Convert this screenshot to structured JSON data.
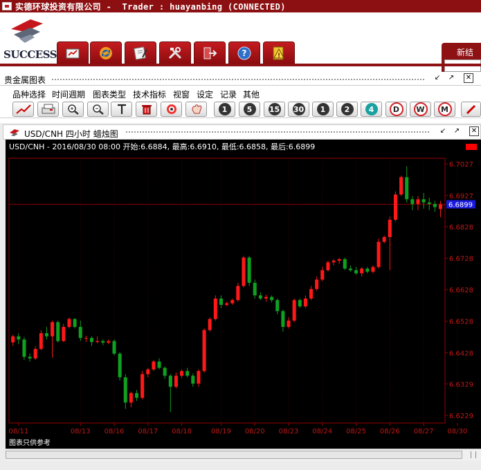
{
  "window": {
    "title": "实德环球投资有限公司 -  Trader : huayanbing (CONNECTED)"
  },
  "logo": {
    "text": "SUCCESS"
  },
  "right_tab": {
    "label": "新结存"
  },
  "main_toolbar": [
    {
      "icon": "chart-book-icon"
    },
    {
      "icon": "refresh-icon"
    },
    {
      "icon": "notes-icon"
    },
    {
      "icon": "tools-icon"
    },
    {
      "icon": "exit-icon"
    },
    {
      "icon": "help-icon"
    },
    {
      "icon": "warning-icon"
    }
  ],
  "panel": {
    "title": "贵金属图表"
  },
  "menu": [
    "品种选择",
    "时间週期",
    "图表类型",
    "技术指标",
    "视窗",
    "设定",
    "记录",
    "其他"
  ],
  "periods": [
    "1",
    "5",
    "15",
    "30",
    "1",
    "2",
    "4"
  ],
  "period_letters": [
    "D",
    "W",
    "M"
  ],
  "chart_window": {
    "title": "USD/CNH 四小时 蜡烛图"
  },
  "chart_data": {
    "type": "candlestick",
    "info": "USD/CNH - 2016/08/30 08:00 开始:6.6884, 最高:6.6910, 最低:6.6858, 最后:6.6899",
    "footer": "图表只供参考",
    "last_price": "6.6899",
    "last_value": 6.6899,
    "y_range": [
      6.6205,
      6.7045
    ],
    "y_ticks": [
      {
        "v": 6.7027,
        "label": "6.7027"
      },
      {
        "v": 6.6927,
        "label": "6.6927"
      },
      {
        "v": 6.6828,
        "label": "6.6828"
      },
      {
        "v": 6.6728,
        "label": "6.6728"
      },
      {
        "v": 6.6628,
        "label": "6.6628"
      },
      {
        "v": 6.6528,
        "label": "6.6528"
      },
      {
        "v": 6.6428,
        "label": "6.6428"
      },
      {
        "v": 6.6329,
        "label": "6.6329"
      },
      {
        "v": 6.6229,
        "label": "6.6229"
      }
    ],
    "x_labels": [
      {
        "i": 1,
        "label": "08/11"
      },
      {
        "i": 12,
        "label": "08/13"
      },
      {
        "i": 18,
        "label": "08/16"
      },
      {
        "i": 24,
        "label": "08/17"
      },
      {
        "i": 30,
        "label": "08/18"
      },
      {
        "i": 37,
        "label": "08/19"
      },
      {
        "i": 43,
        "label": "08/20"
      },
      {
        "i": 49,
        "label": "08/23"
      },
      {
        "i": 55,
        "label": "08/24"
      },
      {
        "i": 61,
        "label": "08/25"
      },
      {
        "i": 67,
        "label": "08/26"
      },
      {
        "i": 73,
        "label": "08/27"
      },
      {
        "i": 79,
        "label": "08/30"
      }
    ],
    "candles": [
      [
        6.6461,
        6.648,
        6.6485,
        6.645
      ],
      [
        6.648,
        6.647,
        6.649,
        6.6455
      ],
      [
        6.647,
        6.6415,
        6.6478,
        6.6405
      ],
      [
        6.6415,
        6.641,
        6.6425,
        6.64
      ],
      [
        6.641,
        6.644,
        6.6448,
        6.6405
      ],
      [
        6.644,
        6.649,
        6.65,
        6.6436
      ],
      [
        6.649,
        6.648,
        6.651,
        6.647
      ],
      [
        6.648,
        6.6525,
        6.653,
        6.6412
      ],
      [
        6.6525,
        6.6465,
        6.653,
        6.646
      ],
      [
        6.6465,
        6.651,
        6.652,
        6.6462
      ],
      [
        6.651,
        6.6535,
        6.654,
        6.6505
      ],
      [
        6.6535,
        6.651,
        6.6538,
        6.6505
      ],
      [
        6.651,
        6.6475,
        6.653,
        6.6465
      ],
      [
        6.6475,
        6.6475,
        6.6482,
        6.6462
      ],
      [
        6.6475,
        6.6462,
        6.648,
        6.645
      ],
      [
        6.6462,
        6.6465,
        6.648,
        6.6458
      ],
      [
        6.6465,
        6.646,
        6.647,
        6.6452
      ],
      [
        6.646,
        6.6465,
        6.647,
        6.6455
      ],
      [
        6.6465,
        6.6425,
        6.647,
        6.642
      ],
      [
        6.6425,
        6.635,
        6.643,
        6.634
      ],
      [
        6.635,
        6.627,
        6.636,
        6.625
      ],
      [
        6.627,
        6.63,
        6.6305,
        6.6255
      ],
      [
        6.63,
        6.6285,
        6.631,
        6.6275
      ],
      [
        6.6285,
        6.636,
        6.637,
        6.628
      ],
      [
        6.636,
        6.6375,
        6.638,
        6.635
      ],
      [
        6.6375,
        6.64,
        6.6405,
        6.637
      ],
      [
        6.64,
        6.638,
        6.641,
        6.6375
      ],
      [
        6.638,
        6.6355,
        6.6385,
        6.6345
      ],
      [
        6.6355,
        6.632,
        6.636,
        6.624
      ],
      [
        6.632,
        6.6355,
        6.6365,
        6.6315
      ],
      [
        6.6355,
        6.637,
        6.6375,
        6.6348
      ],
      [
        6.637,
        6.6355,
        6.638,
        6.635
      ],
      [
        6.6355,
        6.633,
        6.6362,
        6.632
      ],
      [
        6.633,
        6.637,
        6.6375,
        6.632
      ],
      [
        6.637,
        6.65,
        6.6505,
        6.6365
      ],
      [
        6.65,
        6.6535,
        6.654,
        6.6495
      ],
      [
        6.6535,
        6.66,
        6.661,
        6.653
      ],
      [
        6.66,
        6.658,
        6.661,
        6.657
      ],
      [
        6.658,
        6.6585,
        6.659,
        6.6575
      ],
      [
        6.6585,
        6.6595,
        6.66,
        6.658
      ],
      [
        6.6595,
        6.664,
        6.665,
        6.659
      ],
      [
        6.664,
        6.673,
        6.6735,
        6.6635
      ],
      [
        6.673,
        6.665,
        6.6735,
        6.664
      ],
      [
        6.665,
        6.661,
        6.666,
        6.66
      ],
      [
        6.661,
        6.66,
        6.662,
        6.6595
      ],
      [
        6.66,
        6.6605,
        6.6612,
        6.659
      ],
      [
        6.6605,
        6.6595,
        6.661,
        6.6588
      ],
      [
        6.6595,
        6.656,
        6.66,
        6.655
      ],
      [
        6.656,
        6.651,
        6.6565,
        6.6495
      ],
      [
        6.651,
        6.653,
        6.654,
        6.6505
      ],
      [
        6.653,
        6.6595,
        6.66,
        6.6525
      ],
      [
        6.6595,
        6.6575,
        6.66,
        6.657
      ],
      [
        6.6575,
        6.66,
        6.661,
        6.657
      ],
      [
        6.66,
        6.663,
        6.664,
        6.6595
      ],
      [
        6.663,
        6.666,
        6.667,
        6.6625
      ],
      [
        6.666,
        6.669,
        6.67,
        6.6655
      ],
      [
        6.669,
        6.6715,
        6.672,
        6.6685
      ],
      [
        6.6715,
        6.672,
        6.6725,
        6.6705
      ],
      [
        6.672,
        6.6725,
        6.6728,
        6.671
      ],
      [
        6.6725,
        6.6695,
        6.673,
        6.669
      ],
      [
        6.6695,
        6.669,
        6.6705,
        6.6685
      ],
      [
        6.669,
        6.668,
        6.67,
        6.6675
      ],
      [
        6.668,
        6.6695,
        6.67,
        6.667
      ],
      [
        6.6695,
        6.6685,
        6.67,
        6.668
      ],
      [
        6.6685,
        6.67,
        6.6705,
        6.668
      ],
      [
        6.67,
        6.678,
        6.679,
        6.6695
      ],
      [
        6.678,
        6.6795,
        6.68,
        6.6775
      ],
      [
        6.6795,
        6.685,
        6.686,
        6.669
      ],
      [
        6.685,
        6.693,
        6.694,
        6.6845
      ],
      [
        6.693,
        6.6985,
        6.699,
        6.6925
      ],
      [
        6.6985,
        6.6915,
        6.702,
        6.6905
      ],
      [
        6.6915,
        6.69,
        6.6925,
        6.688
      ],
      [
        6.69,
        6.6915,
        6.6925,
        6.688
      ],
      [
        6.6915,
        6.6905,
        6.6935,
        6.6885
      ],
      [
        6.6905,
        6.69,
        6.692,
        6.688
      ],
      [
        6.69,
        6.689,
        6.691,
        6.6875
      ],
      [
        6.6884,
        6.6899,
        6.691,
        6.6858
      ]
    ]
  }
}
